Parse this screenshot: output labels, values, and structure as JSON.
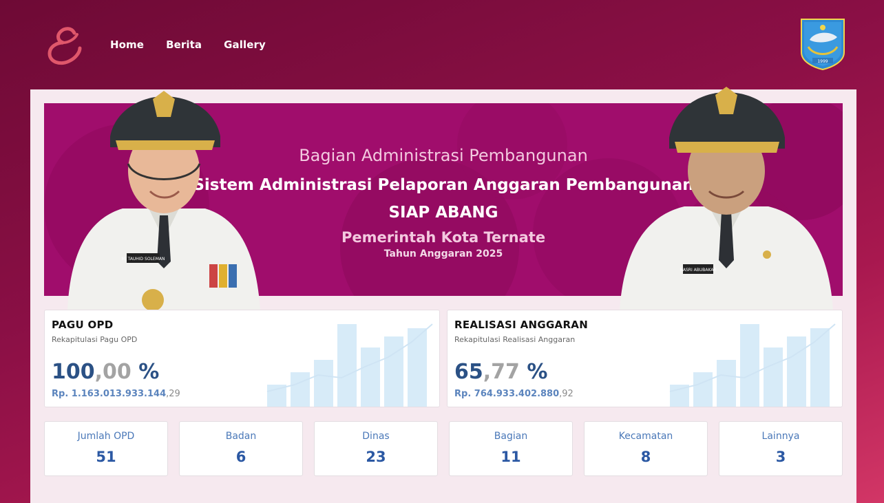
{
  "nav": {
    "logo_icon": "script-e-logo",
    "links": [
      "Home",
      "Berita",
      "Gallery"
    ],
    "crest_icon": "ternate-city-crest",
    "crest_caption": "1999"
  },
  "banner": {
    "line1": "Bagian Administrasi Pembangunan",
    "line2": "Sistem Administrasi Pelaporan Anggaran Pembangunan",
    "line3": "SIAP ABANG",
    "line4": "Pemerintah Kota Ternate",
    "line5": "Tahun Anggaran 2025",
    "left_nametag": "M. TAUHID SOLEMAN",
    "right_nametag": "NASRI ABUBAKAR"
  },
  "pagu": {
    "title": "PAGU OPD",
    "subtitle": "Rekapitulasi Pagu OPD",
    "pct_int": "100",
    "pct_dec": ",00",
    "pct_sign": " %",
    "amount_main": "Rp. 1.163.013.933.144",
    "amount_dec": ",29"
  },
  "realisasi": {
    "title": "REALISASI ANGGARAN",
    "subtitle": "Rekapitulasi Realisasi Anggaran",
    "pct_int": "65",
    "pct_dec": ",77",
    "pct_sign": " %",
    "amount_main": "Rp. 764.933.402.880",
    "amount_dec": ",92"
  },
  "counts": [
    {
      "label": "Jumlah OPD",
      "value": "51"
    },
    {
      "label": "Badan",
      "value": "6"
    },
    {
      "label": "Dinas",
      "value": "23"
    },
    {
      "label": "Bagian",
      "value": "11"
    },
    {
      "label": "Kecamatan",
      "value": "8"
    },
    {
      "label": "Lainnya",
      "value": "3"
    }
  ],
  "colors": {
    "primary_dark": "#6e0a35",
    "banner": "#a00d6c",
    "accent_blue": "#2b5185"
  }
}
